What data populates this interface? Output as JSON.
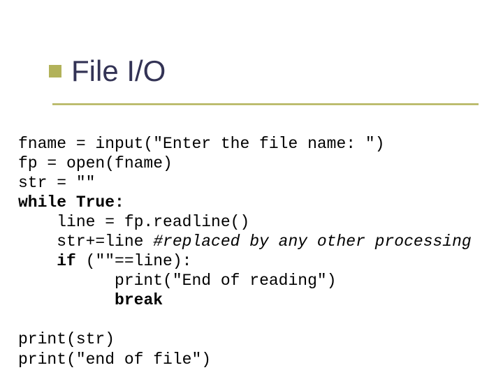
{
  "title": "File I/O",
  "code": {
    "l1a": "fname = input(",
    "l1b": "\"Enter the file name: \"",
    "l1c": ")",
    "l2": "fp = open(fname)",
    "l3a": "str = ",
    "l3b": "\"\"",
    "l4a": "while",
    "l4b": " True:",
    "l5": "    line = fp.readline()",
    "l6a": "    str+=line ",
    "l6b": "#replaced by any other processing",
    "l7a": "    ",
    "l7b": "if",
    "l7c": " (",
    "l7d": "\"\"",
    "l7e": "==line):",
    "l8a": "          print(",
    "l8b": "\"End of reading\"",
    "l8c": ")",
    "l9a": "          ",
    "l9b": "break",
    "blank": "",
    "l10": "print(str)",
    "l11a": "print(",
    "l11b": "\"end of file\"",
    "l11c": ")"
  }
}
